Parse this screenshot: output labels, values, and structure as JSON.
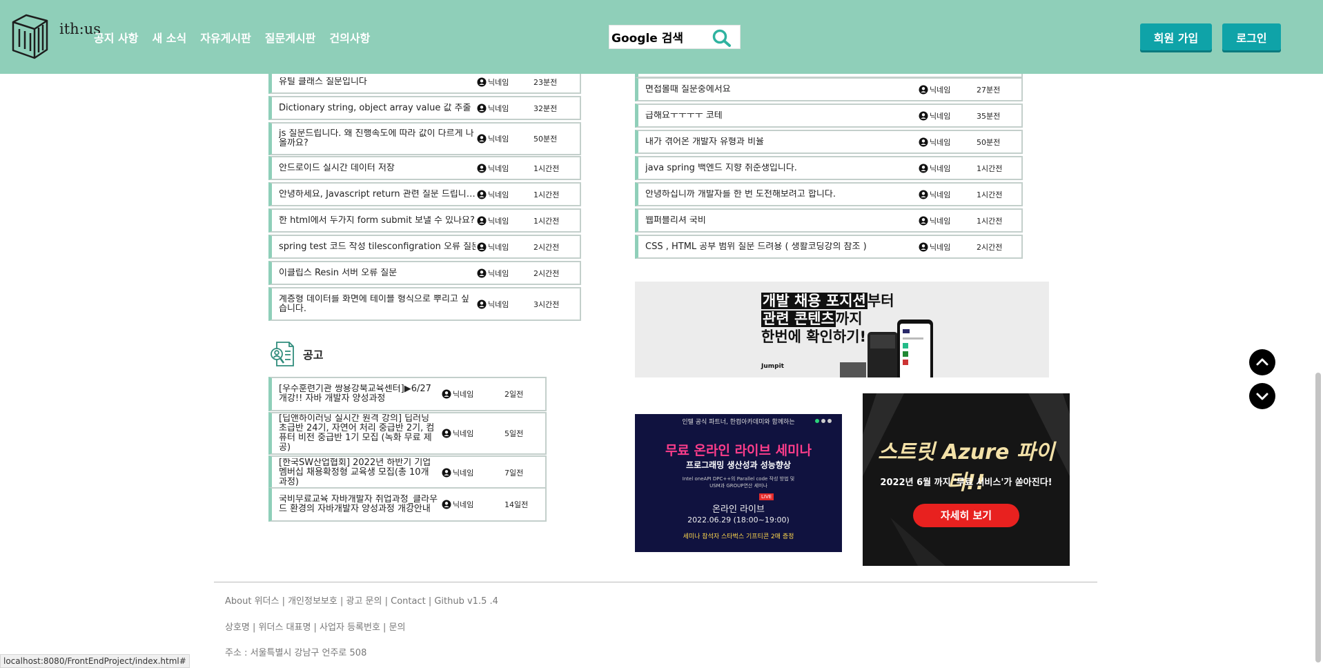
{
  "header": {
    "logo_text": "ith:us",
    "nav": [
      "공지 사항",
      "새 소식",
      "자유게시판",
      "질문게시판",
      "건의사항"
    ],
    "search_value": "Google 검색",
    "join_label": "회원 가입",
    "login_label": "로그인",
    "accent": "#8fcfb9",
    "button_color": "#0fa3a8"
  },
  "left_board": [
    {
      "title": "유틸 클래스 질문입니다",
      "user": "닉네임",
      "time": "23분전"
    },
    {
      "title": "Dictionary string, object array value 값 추출",
      "user": "닉네임",
      "time": "32분전"
    },
    {
      "title": "js 질문드립니다. 왜 진행속도에 따라 값이 다르게 나올까요?",
      "user": "닉네임",
      "time": "50분전"
    },
    {
      "title": "안드로이드 실시간 데이터 저장",
      "user": "닉네임",
      "time": "1시간전"
    },
    {
      "title": "안녕하세요, Javascript return 관련 질문 드립니다..",
      "user": "닉네임",
      "time": "1시간전"
    },
    {
      "title": "한 html에서 두가지 form submit 보낼 수 있나요?",
      "user": "닉네임",
      "time": "1시간전"
    },
    {
      "title": "spring test 코드 작성 tilesconfigration 오류 질문",
      "user": "닉네임",
      "time": "2시간전"
    },
    {
      "title": "이클립스 Resin 서버 오류 질문",
      "user": "닉네임",
      "time": "2시간전"
    },
    {
      "title": "계층형 데이터를 화면에 테이블 형식으로 뿌리고 싶습니다.",
      "user": "닉네임",
      "time": "3시간전"
    }
  ],
  "right_board": [
    {
      "title": "면접볼때 질문중에서요",
      "user": "닉네임",
      "time": "27분전"
    },
    {
      "title": "급해요ㅜㅜㅜㅜ 코테",
      "user": "닉네임",
      "time": "35분전"
    },
    {
      "title": "내가 겪어온 개발자 유형과 비율",
      "user": "닉네임",
      "time": "50분전"
    },
    {
      "title": "java spring 백엔드 지향 취준생입니다.",
      "user": "닉네임",
      "time": "1시간전"
    },
    {
      "title": "안녕하십니까 개발자를 한 번 도전해보려고 합니다.",
      "user": "닉네임",
      "time": "1시간전"
    },
    {
      "title": "웹퍼블리셔 국비",
      "user": "닉네임",
      "time": "1시간전"
    },
    {
      "title": "CSS , HTML 공부 범위 질문 드려용 ( 생활코딩강의 참조 )",
      "user": "닉네임",
      "time": "2시간전"
    }
  ],
  "notice_section": {
    "title": "공고",
    "items": [
      {
        "title": "[우수훈련기관 쌍용강북교육센터]▶6/27개강!! 자바 개발자 양성과정",
        "user": "닉네임",
        "time": "2일전"
      },
      {
        "title": "[딥앤하이러닝 실시간 원격 강의] 딥러닝 초급반 24기, 자연어 처리 중급반 2기, 컴퓨터 비전 중급반 1기 모집 (녹화 무료 제공)",
        "user": "닉네임",
        "time": "5일전"
      },
      {
        "title": "[한국SW산업협회] 2022년 하반기 기업멤버십 채용확정형 교육생 모집(총 10개 과정)",
        "user": "닉네임",
        "time": "7일전"
      },
      {
        "title": "국비무료교육 자바개발자 취업과정_클라우드 환경의 자바개발자 양성과정 개강안내",
        "user": "닉네임",
        "time": "14일전"
      }
    ]
  },
  "ads": {
    "jumpit": {
      "line1a": "개발 채용 포지션",
      "line1b": "부터",
      "line2a": "관련 콘텐츠",
      "line2b": "까지",
      "line3": "한번에 확인하기!",
      "brand": "Jumpit"
    },
    "seminar": {
      "top": "인텔 공식 파트너, 한컴아카데미와 함께하는",
      "headline": "무료 온라인 라이브 세미나",
      "sub": "프로그래밍 생산성과 성능향상",
      "detail1": "Intel oneAPI DPC++의 Parallel code 작성 방법 및",
      "detail2": "USM과 GROUP연산 세미나",
      "live_tag": "LIVE",
      "mode": "온라인 라이브",
      "date": "2022.06.29 (18:00~19:00)",
      "bottom": "세미나 참석자 스타벅스 기프티콘 2매 증정"
    },
    "azure": {
      "headline": "스트릿 Azure 파이터!!",
      "sub": "2022년 6월 까지 '무료 서비스'가 쏟아진다!",
      "button": "자세히 보기"
    }
  },
  "footer": {
    "line1": "About 위더스 | 개인정보보호 | 광고 문의 | Contact | Github v1.5 .4",
    "line2": "상호명 | 위더스 대표명 | 사업자 등록번호 | 문의",
    "line3": "주소 : 서울특별시 강남구 언주로 508"
  },
  "status_url": "localhost:8080/FrontEndProject/index.html#"
}
